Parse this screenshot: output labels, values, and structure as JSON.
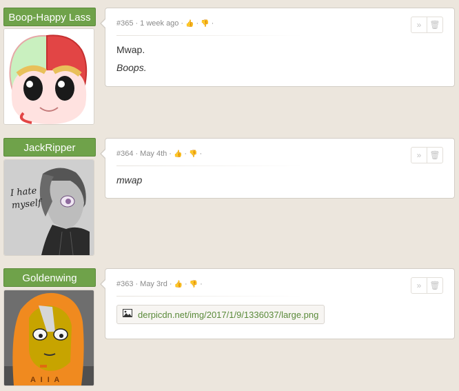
{
  "posts": [
    {
      "username": "Boop-Happy Lass",
      "meta": {
        "id": "#365",
        "time": "1 week ago"
      },
      "lines": [
        "Mwap.",
        "Boops."
      ]
    },
    {
      "username": "JackRipper",
      "meta": {
        "id": "#364",
        "time": "May 4th"
      },
      "lines": [
        "mwap"
      ],
      "avatar_text": [
        "I hate",
        "myself"
      ]
    },
    {
      "username": "Goldenwing",
      "meta": {
        "id": "#363",
        "time": "May 3rd"
      },
      "link": "derpicdn.net/img/2017/1/9/1336037/large.png",
      "avatar_text": "A I I A"
    }
  ],
  "icons": {
    "upvote": "thumbs-up-icon",
    "downvote": "thumbs-down-icon",
    "reply": "double-chevron-icon",
    "delete": "trash-icon",
    "image": "image-icon"
  },
  "colors": {
    "username_bg": "#6fa24a",
    "page_bg": "#ece6dd",
    "link": "#5a8a3a"
  }
}
